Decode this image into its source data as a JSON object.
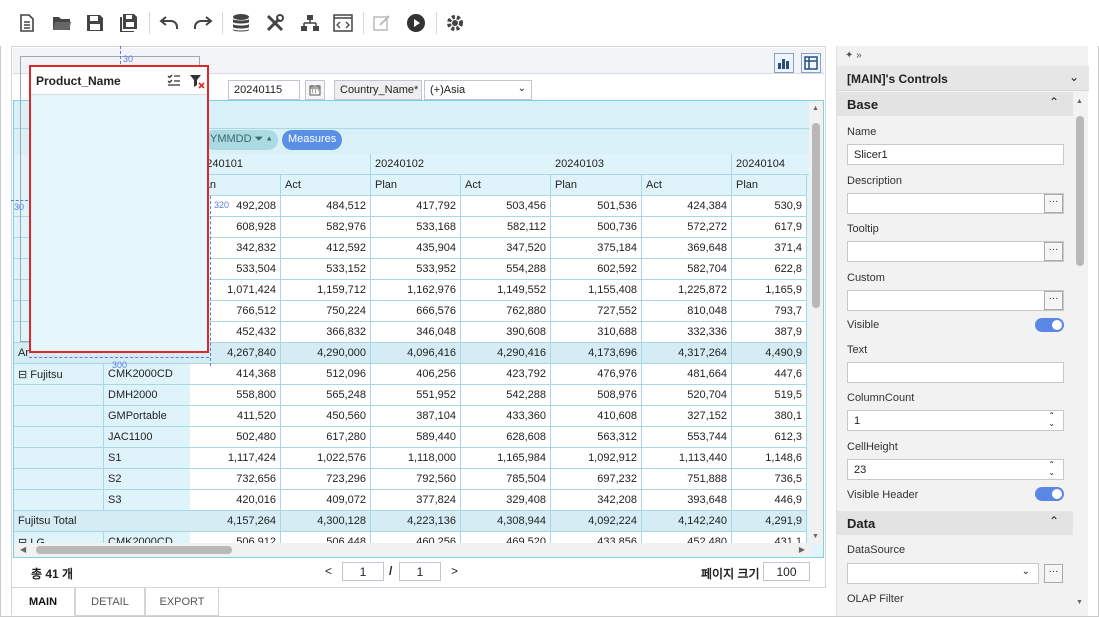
{
  "toolbar": {
    "icons": [
      "new-document-icon",
      "open-folder-icon",
      "save-icon",
      "save-all-icon",
      "undo-icon",
      "redo-icon",
      "database-icon",
      "tools-icon",
      "hierarchy-icon",
      "code-icon",
      "edit-icon",
      "run-icon",
      "settings-icon"
    ]
  },
  "filter": {
    "date": "20240115",
    "country_label": "Country_Name*",
    "country_value": "(+)Asia"
  },
  "pivot": {
    "pill_year": "YMMDD",
    "pill_measures": "Measures",
    "dates": [
      "20240101",
      "20240102",
      "20240103",
      "20240104"
    ],
    "measure_headers": [
      "Plan",
      "Act",
      "Plan",
      "Act",
      "Plan",
      "Act",
      "Plan"
    ],
    "rows": [
      {
        "group": "",
        "item": "",
        "values": [
          "492,208",
          "484,512",
          "417,792",
          "503,456",
          "501,536",
          "424,384",
          "530,9"
        ]
      },
      {
        "group": "",
        "item": "",
        "values": [
          "608,928",
          "582,976",
          "533,168",
          "582,112",
          "500,736",
          "572,272",
          "617,9"
        ]
      },
      {
        "group": "",
        "item": "",
        "values": [
          "342,832",
          "412,592",
          "435,904",
          "347,520",
          "375,184",
          "369,648",
          "371,4"
        ]
      },
      {
        "group": "",
        "item": "",
        "values": [
          "533,504",
          "533,152",
          "533,952",
          "554,288",
          "602,592",
          "582,704",
          "622,8"
        ]
      },
      {
        "group": "",
        "item": "",
        "values": [
          "1,071,424",
          "1,159,712",
          "1,162,976",
          "1,149,552",
          "1,155,408",
          "1,225,872",
          "1,165,9"
        ]
      },
      {
        "group": "",
        "item": "",
        "values": [
          "766,512",
          "750,224",
          "666,576",
          "762,880",
          "727,552",
          "810,048",
          "793,7"
        ]
      },
      {
        "group": "",
        "item": "",
        "values": [
          "452,432",
          "366,832",
          "346,048",
          "390,608",
          "310,688",
          "332,336",
          "387,9"
        ]
      },
      {
        "group": "Ar",
        "item": "",
        "total": true,
        "values": [
          "4,267,840",
          "4,290,000",
          "4,096,416",
          "4,290,416",
          "4,173,696",
          "4,317,264",
          "4,490,9"
        ]
      },
      {
        "group": "⊟ Fujitsu",
        "item": "CMK2000CD",
        "values": [
          "414,368",
          "512,096",
          "406,256",
          "423,792",
          "476,976",
          "481,664",
          "447,6"
        ]
      },
      {
        "group": "",
        "item": "DMH2000",
        "values": [
          "558,800",
          "565,248",
          "551,952",
          "542,288",
          "508,976",
          "520,704",
          "519,5"
        ]
      },
      {
        "group": "",
        "item": "GMPortable",
        "values": [
          "411,520",
          "450,560",
          "387,104",
          "433,360",
          "410,608",
          "327,152",
          "380,1"
        ]
      },
      {
        "group": "",
        "item": "JAC1100",
        "values": [
          "502,480",
          "617,280",
          "589,440",
          "628,608",
          "563,312",
          "553,744",
          "612,3"
        ]
      },
      {
        "group": "",
        "item": "S1",
        "values": [
          "1,117,424",
          "1,022,576",
          "1,118,000",
          "1,165,984",
          "1,092,912",
          "1,113,440",
          "1,148,6"
        ]
      },
      {
        "group": "",
        "item": "S2",
        "values": [
          "732,656",
          "723,296",
          "792,560",
          "785,504",
          "697,232",
          "751,888",
          "736,5"
        ]
      },
      {
        "group": "",
        "item": "S3",
        "values": [
          "420,016",
          "409,072",
          "377,824",
          "329,408",
          "342,208",
          "393,648",
          "446,9"
        ]
      },
      {
        "group": "Fujitsu Total",
        "item": "",
        "total": true,
        "values": [
          "4,157,264",
          "4,300,128",
          "4,223,136",
          "4,308,944",
          "4,092,224",
          "4,142,240",
          "4,291,9"
        ]
      },
      {
        "group": "⊟ LG",
        "item": "CMK2000CD",
        "values": [
          "506,912",
          "506,448",
          "460,256",
          "469,520",
          "433,856",
          "452,480",
          "431,1"
        ]
      }
    ]
  },
  "pager": {
    "total_label": "총  41 개",
    "current_page": "1",
    "slash": "/",
    "total_pages": "1",
    "page_size_label": "페이지 크기",
    "page_size": "100"
  },
  "tabs": [
    "MAIN",
    "DETAIL",
    "EXPORT"
  ],
  "slicer": {
    "title": "Product_Name",
    "guide_top": "30",
    "guide_left": "30",
    "guide_right": "320",
    "guide_bottom": "300"
  },
  "panel": {
    "title": "[MAIN]'s Controls",
    "section_base": "Base",
    "name_label": "Name",
    "name_value": "Slicer1",
    "description_label": "Description",
    "tooltip_label": "Tooltip",
    "custom_label": "Custom",
    "visible_label": "Visible",
    "text_label": "Text",
    "columncount_label": "ColumnCount",
    "columncount_value": "1",
    "cellheight_label": "CellHeight",
    "cellheight_value": "23",
    "visible_header_label": "Visible Header",
    "section_data": "Data",
    "datasource_label": "DataSource",
    "olap_filter_label": "OLAP Filter"
  },
  "colors": {
    "accent": "#5b87e4",
    "selection": "#e02626",
    "grid_border": "#7fd0e6"
  }
}
